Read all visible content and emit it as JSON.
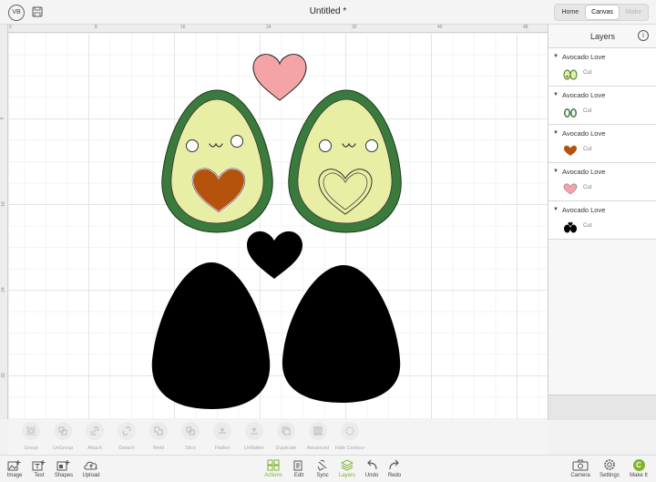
{
  "header": {
    "avatar_initials": "VB",
    "document_title": "Untitled *",
    "modes": [
      {
        "label": "Home",
        "state": "normal"
      },
      {
        "label": "Canvas",
        "state": "active"
      },
      {
        "label": "Make",
        "state": "disabled"
      }
    ]
  },
  "rulers": {
    "top_ticks": [
      "0",
      "8",
      "16",
      "24",
      "32",
      "40",
      "48"
    ],
    "left_ticks": [
      "8",
      "16",
      "24",
      "32"
    ]
  },
  "canvas": {
    "colors": {
      "avocado_flesh": "#e8eea3",
      "avocado_skin": "#3b7a3d",
      "heart_pink": "#f4a4a6",
      "pit_brown": "#b5530d",
      "silhouette": "#000000"
    }
  },
  "layers_panel": {
    "title": "Layers",
    "groups": [
      {
        "name": "Avocado Love",
        "operation": "Cut",
        "thumbnail": "avocado-pair-light"
      },
      {
        "name": "Avocado Love",
        "operation": "Cut",
        "thumbnail": "avocado-pair-green"
      },
      {
        "name": "Avocado Love",
        "operation": "Cut",
        "thumbnail": "heart-brown"
      },
      {
        "name": "Avocado Love",
        "operation": "Cut",
        "thumbnail": "heart-pink"
      },
      {
        "name": "Avocado Love",
        "operation": "Cut",
        "thumbnail": "black-shapes"
      }
    ]
  },
  "actions_bar": {
    "items": [
      {
        "label": "Group",
        "icon": "group-icon"
      },
      {
        "label": "UnGroup",
        "icon": "ungroup-icon"
      },
      {
        "label": "Attach",
        "icon": "attach-icon"
      },
      {
        "label": "Detach",
        "icon": "detach-icon"
      },
      {
        "label": "Weld",
        "icon": "weld-icon"
      },
      {
        "label": "Slice",
        "icon": "slice-icon"
      },
      {
        "label": "Flatten",
        "icon": "flatten-icon"
      },
      {
        "label": "Unflatten",
        "icon": "unflatten-icon"
      },
      {
        "label": "Duplicate",
        "icon": "duplicate-icon"
      },
      {
        "label": "Advanced",
        "icon": "advanced-icon"
      },
      {
        "label": "Hide Contour",
        "icon": "hide-contour-icon"
      }
    ]
  },
  "bottom_bar": {
    "left": [
      {
        "label": "Image",
        "icon": "image-icon"
      },
      {
        "label": "Text",
        "icon": "text-icon"
      },
      {
        "label": "Shapes",
        "icon": "shapes-icon"
      },
      {
        "label": "Upload",
        "icon": "upload-icon"
      }
    ],
    "center": [
      {
        "label": "Actions",
        "icon": "actions-icon",
        "active": true
      },
      {
        "label": "Edit",
        "icon": "edit-icon",
        "active": false
      },
      {
        "label": "Sync",
        "icon": "sync-icon",
        "active": false
      },
      {
        "label": "Layers",
        "icon": "layers-icon",
        "active": true
      },
      {
        "label": "Undo",
        "icon": "undo-icon",
        "active": false
      },
      {
        "label": "Redo",
        "icon": "redo-icon",
        "active": false
      }
    ],
    "right": [
      {
        "label": "Camera",
        "icon": "camera-icon"
      },
      {
        "label": "Settings",
        "icon": "settings-icon"
      },
      {
        "label": "Make It",
        "icon": "make-it-icon",
        "badge": "C"
      }
    ]
  }
}
